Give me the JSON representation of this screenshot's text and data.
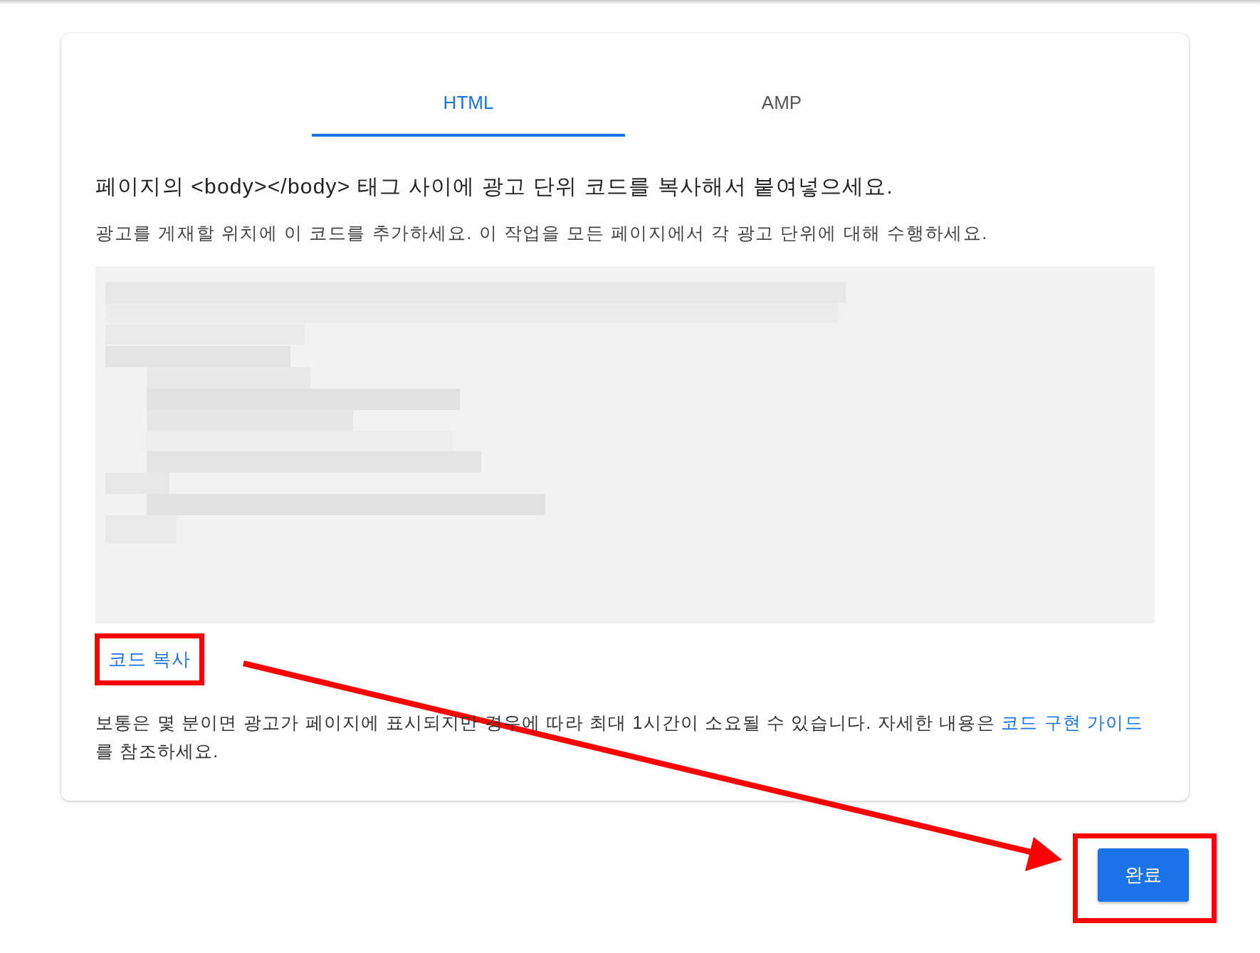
{
  "tabs": [
    {
      "label": "HTML",
      "selected": true
    },
    {
      "label": "AMP",
      "selected": false
    }
  ],
  "heading": "페이지의 <body></body> 태그 사이에 광고 단위 코드를 복사해서 붙여넣으세요.",
  "subtext": "광고를 게재할 위치에 이 코드를 추가하세요. 이 작업을 모든 페이지에서 각 광고 단위에 대해 수행하세요.",
  "copy_link": "코드 복사",
  "note": {
    "text_before": "보통은 몇 분이면 광고가 페이지에 표시되지만 경우에 따라 최대 1시간이 소요될 수 있습니다. 자세한 내용은 ",
    "link": "코드 구현 가이드",
    "text_after": "를 참조하세요."
  },
  "done_button": "완료"
}
